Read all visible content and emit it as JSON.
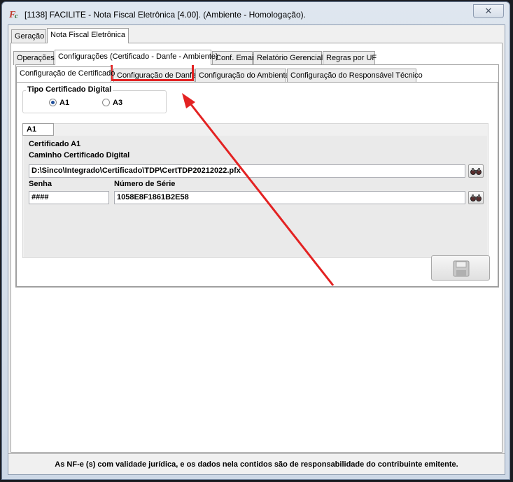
{
  "window": {
    "title": "[1138] FACILITE - Nota Fiscal Eletrônica [4.00]. (Ambiente - Homologação).",
    "close_symbol": "✕"
  },
  "main_tabs": [
    "Geração",
    "Nota Fiscal Eletrônica"
  ],
  "config_tabs": [
    "Operações",
    "Configurações (Certificado - Danfe - Ambiente)",
    "Conf. Email",
    "Relatório Gerencial",
    "Regras por UF"
  ],
  "sub_tabs": [
    "Configuração de Certificado",
    "Configuração de Danfe",
    "Configuração do Ambiente",
    "Configuração do Responsável Técnico"
  ],
  "tipo_certificado": {
    "label": "Tipo Certificado Digital",
    "options": [
      "A1",
      "A3"
    ],
    "selected": "A1"
  },
  "cert_tab_label": "A1",
  "certificado": {
    "group_label": "Certificado A1",
    "path_label": "Caminho Certificado Digital",
    "path_value": "D:\\Sinco\\Integrado\\Certificado\\TDP\\CertTDP20212022.pfx",
    "senha_label": "Senha",
    "senha_value": "####",
    "serie_label": "Número de Série",
    "serie_value": "1058E8F1861B2E58"
  },
  "footer_text": "As NF-e (s) com validade jurídica, e os dados nela contidos são de responsabilidade do contribuinte emitente.",
  "colors": {
    "highlight": "#e32222",
    "accent": "#1f4f9b"
  }
}
